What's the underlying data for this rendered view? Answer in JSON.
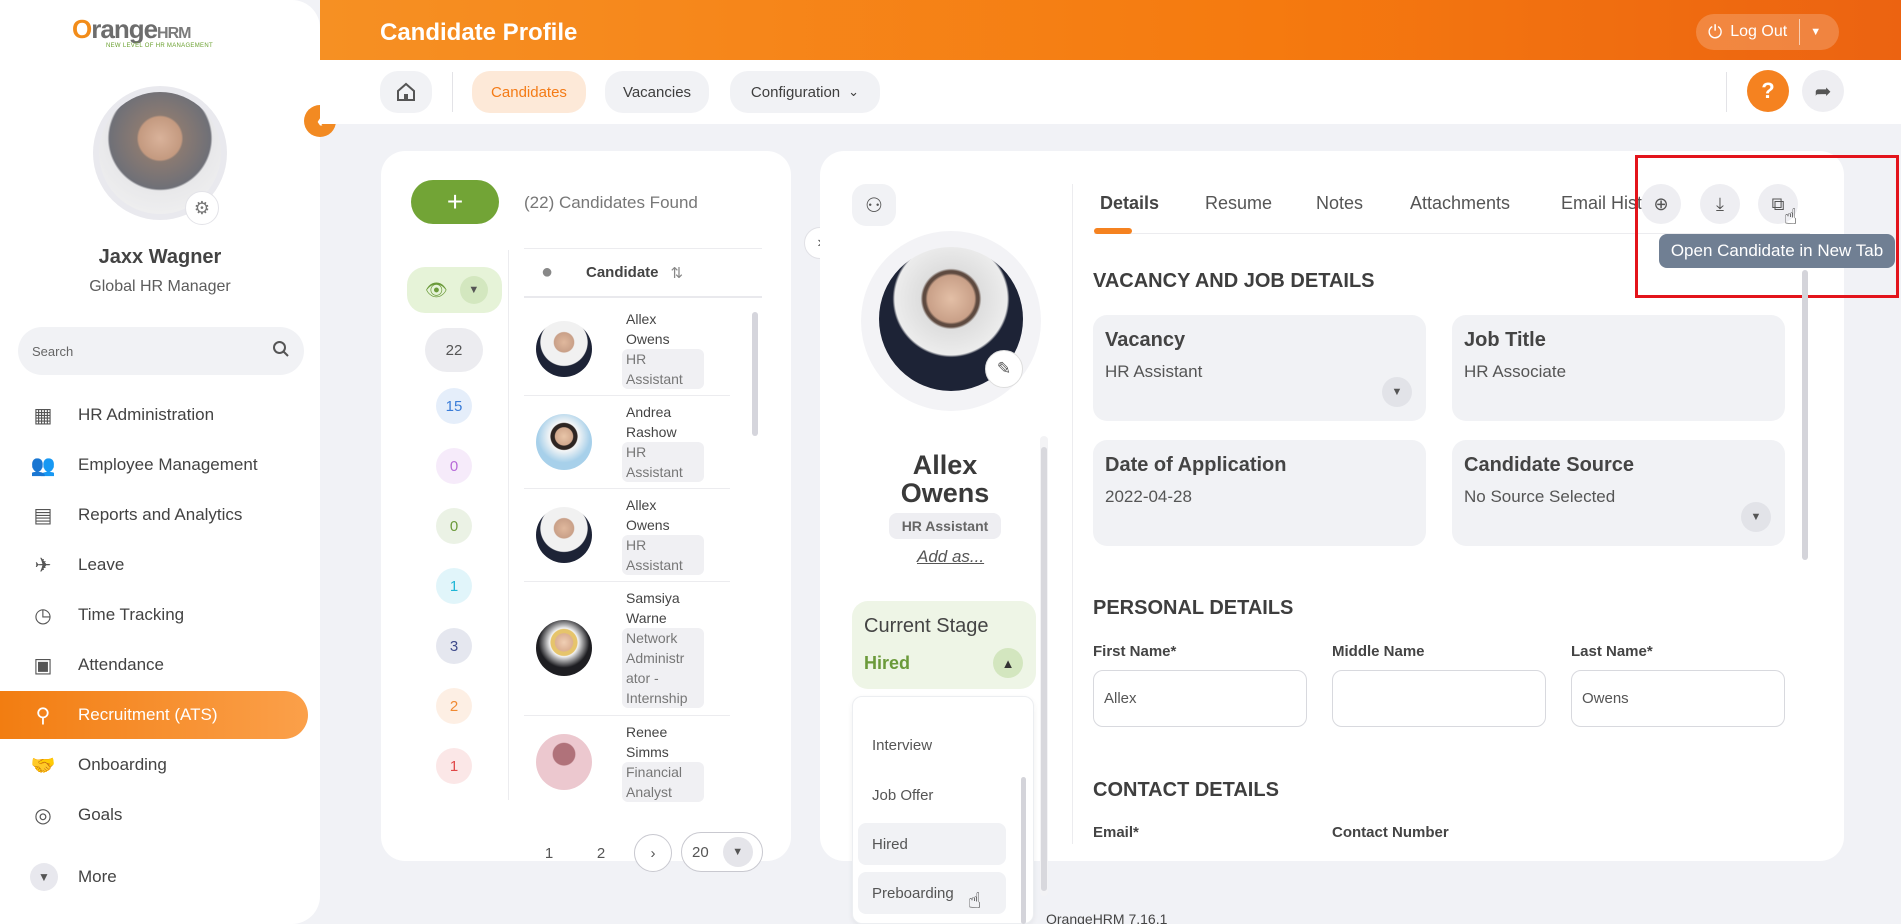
{
  "sidebar": {
    "logo_brand": "range",
    "logo_hrm": "HRM",
    "logo_tagline": "NEW LEVEL OF HR MANAGEMENT",
    "user_name": "Jaxx Wagner",
    "user_role": "Global HR Manager",
    "search_placeholder": "Search",
    "items": [
      {
        "label": "HR Administration",
        "icon": "building-icon"
      },
      {
        "label": "Employee Management",
        "icon": "people-icon"
      },
      {
        "label": "Reports and Analytics",
        "icon": "report-icon"
      },
      {
        "label": "Leave",
        "icon": "leave-icon"
      },
      {
        "label": "Time Tracking",
        "icon": "clock-icon"
      },
      {
        "label": "Attendance",
        "icon": "attendance-icon"
      },
      {
        "label": "Recruitment (ATS)",
        "icon": "recruitment-icon",
        "active": true
      },
      {
        "label": "Onboarding",
        "icon": "handshake-icon"
      },
      {
        "label": "Goals",
        "icon": "target-icon"
      }
    ],
    "more_label": "More"
  },
  "header": {
    "title": "Candidate Profile",
    "logout_label": "Log Out",
    "nav": {
      "candidates": "Candidates",
      "vacancies": "Vacancies",
      "configuration": "Configuration"
    }
  },
  "candidates_panel": {
    "found_text": "(22) Candidates Found",
    "column_candidate": "Candidate",
    "filter_counts": [
      {
        "value": "22",
        "color": "#555555"
      },
      {
        "value": "15",
        "color": "#3b7dd8"
      },
      {
        "value": "0",
        "color": "#b86ad8"
      },
      {
        "value": "0",
        "color": "#6b9a3a"
      },
      {
        "value": "1",
        "color": "#1fb6d6"
      },
      {
        "value": "3",
        "color": "#3e4a8a"
      },
      {
        "value": "2",
        "color": "#f08a32"
      },
      {
        "value": "1",
        "color": "#e04848"
      }
    ],
    "rows": [
      {
        "first": "Allex",
        "last": "Owens",
        "job_lines": [
          "HR",
          "Assistant"
        ]
      },
      {
        "first": "Andrea",
        "last": "Rashow",
        "job_lines": [
          "HR",
          "Assistant"
        ]
      },
      {
        "first": "Allex",
        "last": "Owens",
        "job_lines": [
          "HR",
          "Assistant"
        ]
      },
      {
        "first": "Samsiya",
        "last": "Warne",
        "job_lines": [
          "Network",
          "Administr",
          "ator -",
          "Internship"
        ]
      },
      {
        "first": "Renee",
        "last": "Simms",
        "job_lines": [
          "Financial",
          "Analyst"
        ]
      }
    ],
    "pagination": {
      "page1": "1",
      "page2": "2",
      "page_size": "20"
    }
  },
  "profile": {
    "first_name": "Allex",
    "last_name": "Owens",
    "job_badge": "HR Assistant",
    "add_as": "Add as...",
    "current_stage_label": "Current Stage",
    "current_stage_value": "Hired",
    "stage_options": [
      "Interview",
      "Job Offer",
      "Hired",
      "Preboarding"
    ],
    "tabs": [
      "Details",
      "Resume",
      "Notes",
      "Attachments",
      "Email Histo"
    ],
    "tooltip": "Open Candidate in New Tab",
    "sections": {
      "vacancy": "VACANCY AND JOB DETAILS",
      "personal": "PERSONAL DETAILS",
      "contact": "CONTACT DETAILS"
    },
    "vacancy": {
      "label": "Vacancy",
      "value": "HR Assistant"
    },
    "job_title": {
      "label": "Job Title",
      "value": "HR Associate"
    },
    "date_of_application": {
      "label": "Date of Application",
      "value": "2022-04-28"
    },
    "candidate_source": {
      "label": "Candidate Source",
      "value": "No Source Selected"
    },
    "personal_fields": {
      "first_name_label": "First Name*",
      "first_name_value": "Allex",
      "middle_name_label": "Middle Name",
      "middle_name_value": "",
      "last_name_label": "Last Name*",
      "last_name_value": "Owens"
    },
    "contact_fields": {
      "email_label": "Email*",
      "contact_label": "Contact Number"
    }
  },
  "footer": {
    "version": "OrangeHRM 7.16.1"
  },
  "colors": {
    "accent": "#f58220",
    "success": "#72a436",
    "highlight_box": "#e3141b"
  }
}
